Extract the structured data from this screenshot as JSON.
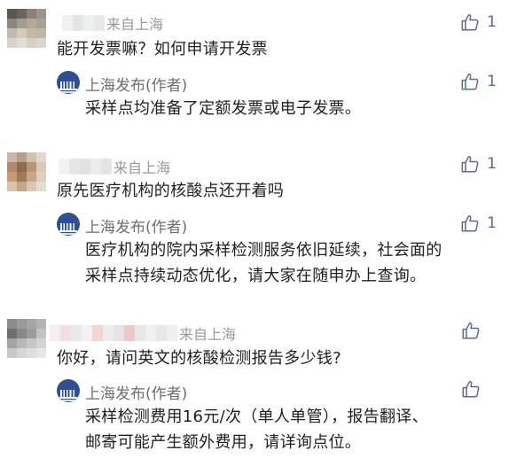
{
  "comments": [
    {
      "meta_text": "来自上海",
      "text_lines": [
        "能开发票嘛？如何申请开发票"
      ],
      "like_count": "1",
      "reply": {
        "author": "上海发布(作者)",
        "like_count": "1",
        "text_lines": [
          "采样点均准备了定额发票或电子发票。"
        ]
      }
    },
    {
      "meta_text": "来自上海",
      "text_lines": [
        "原先医疗机构的核酸点还开着吗"
      ],
      "like_count": "1",
      "reply": {
        "author": "上海发布(作者)",
        "like_count": "1",
        "text_lines": [
          "医疗机构的院内采样检测服务依旧延续，社会面的",
          "采样点持续动态优化，请大家在随申办上查询。"
        ]
      }
    },
    {
      "meta_text": "来自上海",
      "text_lines": [
        "你好，请问英文的核酸检测报告多少钱?"
      ],
      "like_count": "",
      "reply": {
        "author": "上海发布(作者)",
        "like_count": "",
        "text_lines": [
          "采样检测费用16元/次（单人单管），报告翻译、",
          "邮寄可能产生额外费用，请详询点位。"
        ]
      }
    }
  ],
  "colors": {
    "like_icon": "#5a6b8c",
    "meta_text": "#9a9a9a",
    "author_text": "#6e6e6e",
    "logo_bg": "#2d4f95"
  }
}
